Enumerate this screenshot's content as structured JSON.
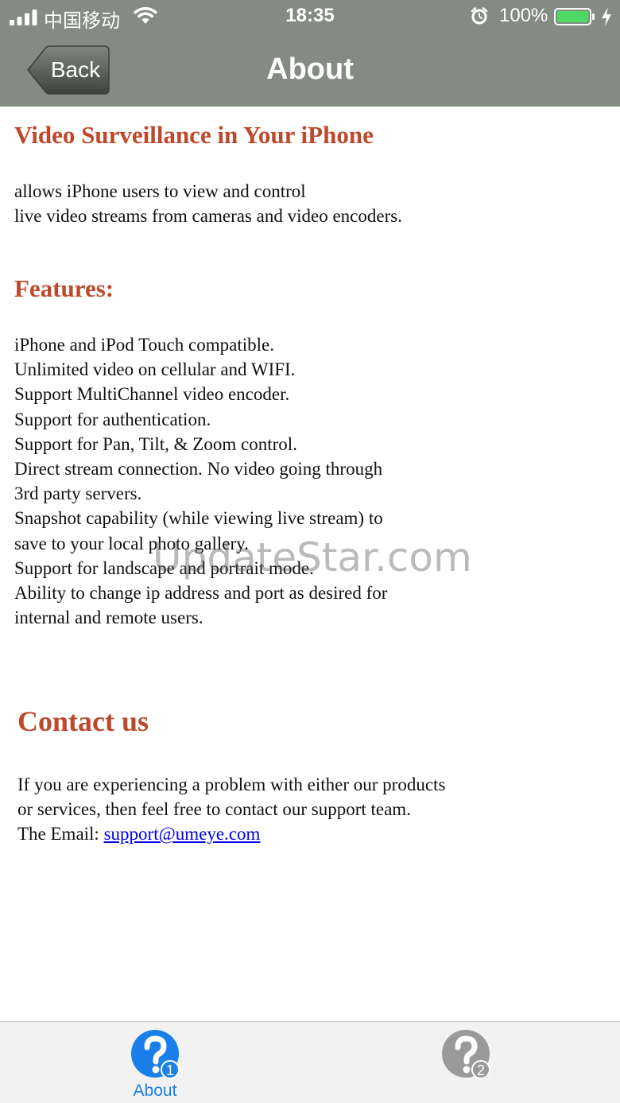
{
  "status_bar": {
    "carrier": "中国移动",
    "time": "18:35",
    "battery": "100%"
  },
  "nav": {
    "back_label": "Back",
    "title": "About"
  },
  "content": {
    "heading_main": "Video Surveillance in Your iPhone",
    "intro_lines": [
      "allows iPhone users to view and control",
      "live video streams from cameras and video encoders."
    ],
    "features_heading": "Features:",
    "feature_lines": [
      "iPhone and iPod Touch compatible.",
      "Unlimited video on cellular and WIFI.",
      "Support MultiChannel video encoder.",
      "Support for authentication.",
      "Support for Pan, Tilt, & Zoom control.",
      "Direct stream connection. No video going through",
      "3rd party servers.",
      "Snapshot capability (while viewing live stream) to",
      "save to your local photo gallery.",
      "Support for landscape and portrait mode.",
      "Ability to change ip address and port as desired for",
      "internal and remote users."
    ],
    "contact_heading": "Contact us",
    "contact_lines": [
      "If you are experiencing a problem with either our products",
      "or services, then feel free to contact our support team."
    ],
    "email_prefix": "The Email: ",
    "email": "support@umeye.com"
  },
  "watermark": "UpdateStar.com",
  "tab_bar": {
    "tabs": [
      {
        "label": "About",
        "badge": "1",
        "active": true,
        "icon": "help-icon"
      },
      {
        "label": "",
        "badge": "2",
        "active": false,
        "icon": "help-icon"
      }
    ]
  },
  "colors": {
    "header_bg": "#838b83",
    "heading": "#c0482a",
    "link": "#0000ee",
    "tab_active": "#1a7fe8",
    "tab_inactive": "#9a9a9a",
    "battery": "#4cd964"
  }
}
